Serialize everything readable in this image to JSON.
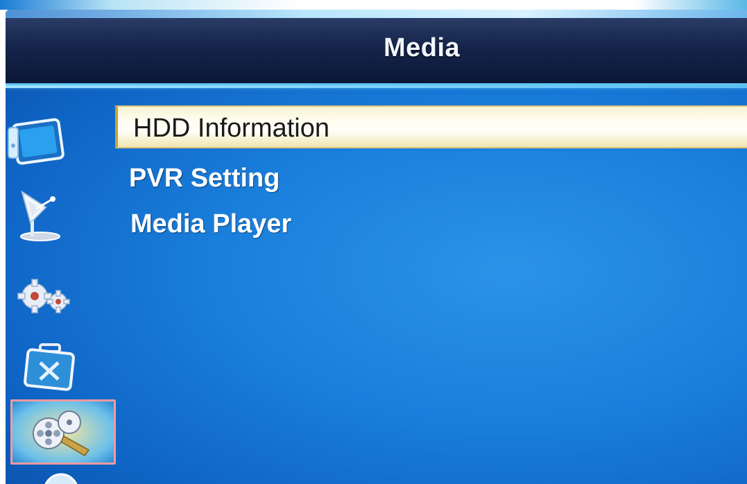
{
  "header": {
    "title": "Media"
  },
  "menu": {
    "items": [
      {
        "label": "HDD Information",
        "selected": true
      },
      {
        "label": "PVR Setting",
        "selected": false
      },
      {
        "label": "Media Player",
        "selected": false
      }
    ]
  },
  "sidebar": {
    "icons": [
      {
        "name": "tv-icon",
        "selected": false
      },
      {
        "name": "satellite-dish-icon",
        "selected": false
      },
      {
        "name": "gears-icon",
        "selected": false
      },
      {
        "name": "toolbox-icon",
        "selected": false
      },
      {
        "name": "film-reel-icon",
        "selected": true
      },
      {
        "name": "globe-icon",
        "selected": false
      }
    ]
  },
  "colors": {
    "background": "#1a7fdc",
    "title_bar": "#14244a",
    "highlight": "#fffdf0",
    "selected_icon_border": "#f29aa0"
  }
}
